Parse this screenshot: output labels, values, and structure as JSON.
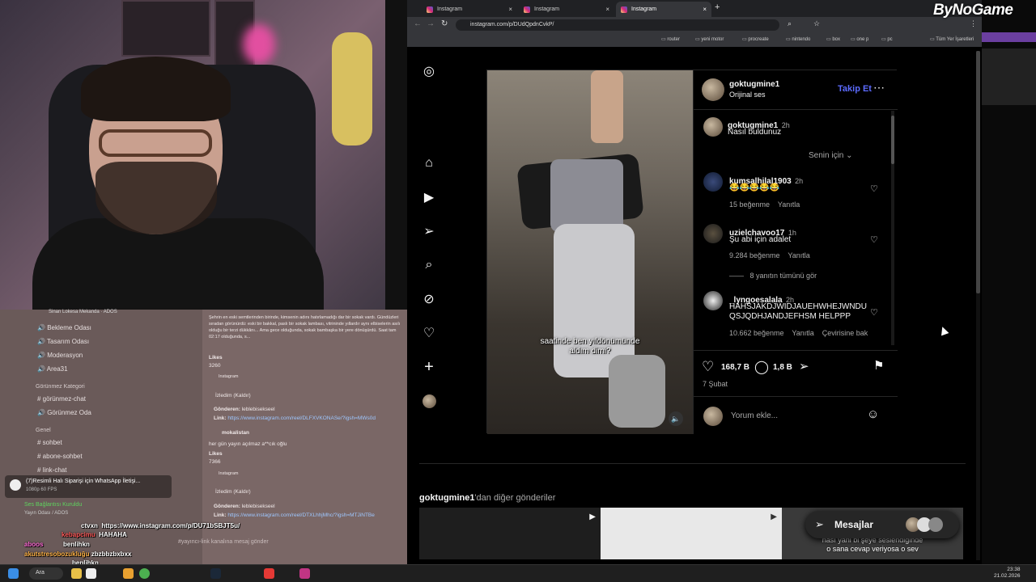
{
  "overlay": {
    "logo": "ByNoGame"
  },
  "browser": {
    "tabs": [
      {
        "label": "Instagram",
        "active": false
      },
      {
        "label": "Instagram",
        "active": false
      },
      {
        "label": "Instagram",
        "active": true
      }
    ],
    "url": "instagram.com/p/DUdQpdnCvkP/",
    "bookmarks": [
      "router",
      "yeni motor",
      "procreate",
      "nintendo",
      "box",
      "one p",
      "pc"
    ],
    "bookmarks_right": "Tüm Yer İşaretleri"
  },
  "post": {
    "author": "goktugmine1",
    "audio": "Orijinal ses",
    "follow_label": "Takip Et",
    "caption_user": "goktugmine1",
    "caption_time": "2h",
    "caption_text": "Nasıl buldunuz",
    "filter_label": "Senin için",
    "video_caption_line1": "saatinde ben yıldönümünde",
    "video_caption_line2": "aldım dimi?",
    "likes": "168,7 B",
    "comments_count": "1,8 B",
    "date": "7 Şubat",
    "comment_placeholder": "Yorum ekle..."
  },
  "comments": [
    {
      "user": "kumsalhilal1903",
      "time": "2h",
      "text": "😂😂😂😂😂",
      "likes": "15 beğenme",
      "reply": "Yanıtla",
      "extra": ""
    },
    {
      "user": "uzielchavoo17",
      "time": "1h",
      "text": "Şu abi için adalet",
      "likes": "9.284 beğenme",
      "reply": "Yanıtla",
      "extra": ""
    },
    {
      "user": "_lyngoesalala",
      "time": "2h",
      "text": "HAHSJAKDJWIDJAUEHWHEJWNDU QSJQDHJANDJEFHSM HELPPP",
      "likes": "10.662 beğenme",
      "reply": "Yanıtla",
      "extra": "Çevirisine bak"
    }
  ],
  "view_replies": "8 yanıtın tümünü gör",
  "more_posts": {
    "author": "goktugmine1",
    "suffix": "'dan diğer gönderiler",
    "thumb3_line1": "nası yani bi şeye seslendiğinde",
    "thumb3_line2": "o sana cevap veriyosa o sev"
  },
  "messages_label": "Mesajlar",
  "discord": {
    "voice_channels": [
      "Bekleme Odası",
      "Tasarım Odası",
      "Moderasyon",
      "Area31"
    ],
    "hidden_category": "Görünmez Kategori",
    "hidden_channels": [
      "görünmez-chat",
      "Görünmez Oda"
    ],
    "general_category": "Genel",
    "general_channels": [
      "sohbet",
      "abone-sohbet",
      "link-chat"
    ],
    "voice_user": "Sinan Lokesa Mekanda · ADOS",
    "notification": "(7)Resimli Halı Siparişi için WhatsApp İletişi...",
    "notification_sub": "1080p 60 FPS",
    "voice_status": "Ses Bağlantısı Kuruldu",
    "voice_sub": "Yayın Odası / ADOS",
    "message_placeholder": "#yayıncı-link kanalına mesaj gönder",
    "chat": {
      "post_text": "Şehrin en eski semtlerinden birinde, kimsenin adını hatırlamadığı dar bir sokak vardı. Gündüzleri sıradan görünürdü: eski bir bakkal, paslı bir sokak lambası, vitrininde yıllardır aynı elbiselerin asılı olduğu bir terzi dükkânı... Ama gece olduğunda, sokak bambaşka bir yere dönüşürdü.",
      "post_time": "Saat tam 02:17 olduğunda, s...",
      "likes_label": "Likes",
      "likes1": "3260",
      "source1": "Instagram",
      "deleted1": "İzledim (Kaldır)",
      "sender_label": "Gönderen:",
      "sender1": "leblebisekseel",
      "link_label": "Link:",
      "link1": "https://www.instagram.com/reel/DLFXVKONASe/?igsh=MWs0d",
      "user2": "mokalistan",
      "msg2": "her gün yayın açılmaz a**cık oğlu",
      "likes2": "7366",
      "source2": "Instagram",
      "deleted2": "İzledim (Kaldır)",
      "sender2": "leblebisekseel",
      "link2": "https://www.instagram.com/reel/DTXLhhjMhc/?igsh=MTJiNTBe"
    },
    "overlay_lines": [
      {
        "user": "ctvxn",
        "text": "https://www.instagram.com/p/DU71bSBJT5u/"
      },
      {
        "user": "kebapcimu",
        "text": "HAHAHA"
      },
      {
        "user": "aboos",
        "text": "benlihkn"
      },
      {
        "user": "akutstresobozukluğu",
        "text": "zbzbbzbxbxx"
      },
      {
        "user": "",
        "text": "benlihkn"
      }
    ]
  },
  "taskbar": {
    "search": "Ara",
    "time": "23:38",
    "date": "21.02.2026"
  },
  "colors": {
    "instagram_bg": "#000000",
    "follow_blue": "#5c6bff",
    "discord_bg": "#6e5d5c",
    "taskbar": "#1f1f1f"
  }
}
